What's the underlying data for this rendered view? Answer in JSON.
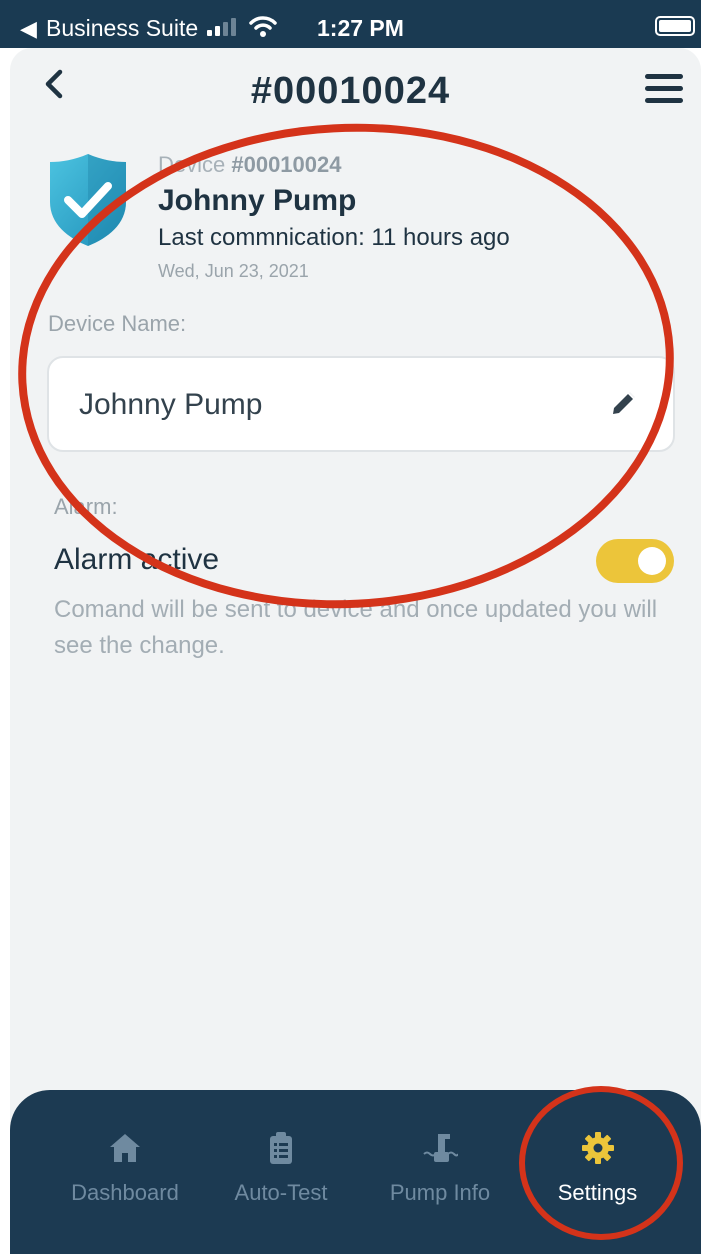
{
  "status_bar": {
    "back_app": "Business Suite",
    "time": "1:27 PM"
  },
  "header": {
    "title": "#00010024"
  },
  "device": {
    "id_prefix": "Device ",
    "id_number": "#00010024",
    "name": "Johnny Pump",
    "last_communication": "Last commnication: 11 hours ago",
    "date": "Wed, Jun 23, 2021"
  },
  "form": {
    "device_name_label": "Device Name:",
    "device_name_value": "Johnny Pump",
    "alarm_label": "Alarm:",
    "alarm_active_label": "Alarm active",
    "alarm_toggle_on": true,
    "alarm_note": "Comand will be sent to device and once updated you will see the change."
  },
  "bottom_nav": {
    "items": [
      {
        "label": "Dashboard",
        "icon": "home-icon",
        "active": false
      },
      {
        "label": "Auto-Test",
        "icon": "clipboard-icon",
        "active": false
      },
      {
        "label": "Pump Info",
        "icon": "pump-icon",
        "active": false
      },
      {
        "label": "Settings",
        "icon": "gear-icon",
        "active": true
      }
    ]
  },
  "colors": {
    "status_bar_bg": "#1a3a52",
    "nav_bg": "#1c3a52",
    "accent_yellow": "#ecc53a",
    "shield_teal": "#3ab0d3",
    "annotation_red": "#d4331a",
    "text_dark": "#1f3342"
  }
}
